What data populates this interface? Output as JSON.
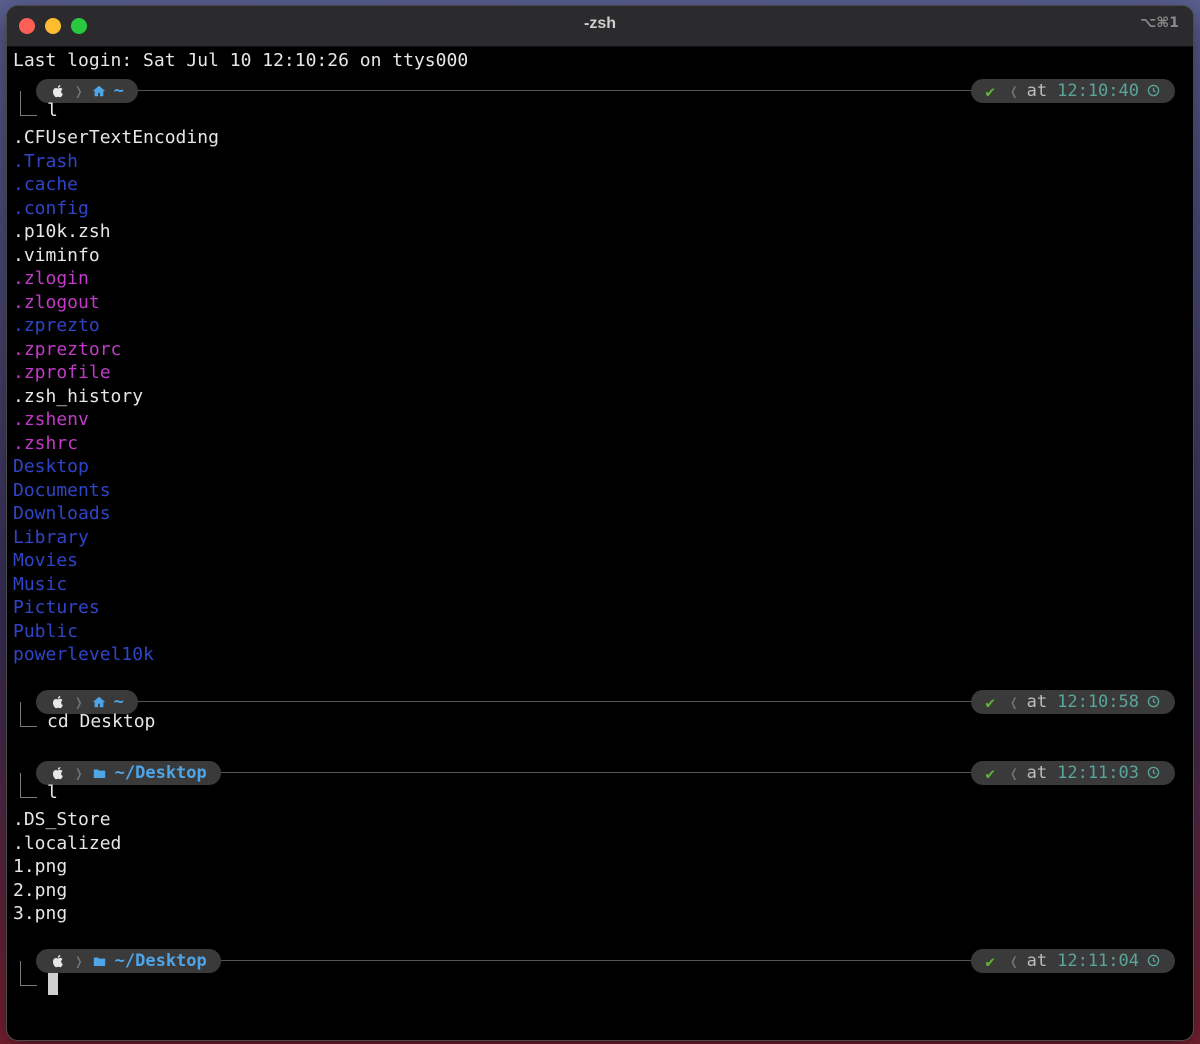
{
  "window": {
    "title": "-zsh",
    "shortcut": "⌥⌘1"
  },
  "last_login": "Last login: Sat Jul 10 12:10:26 on ttys000",
  "prompts": [
    {
      "dir_icon": "home-icon",
      "path": "~",
      "time_label": "at",
      "time": "12:10:40",
      "command": "l"
    },
    {
      "dir_icon": "home-icon",
      "path": "~",
      "time_label": "at",
      "time": "12:10:58",
      "command": "cd Desktop"
    },
    {
      "dir_icon": "folder-icon",
      "path": "~/Desktop",
      "time_label": "at",
      "time": "12:11:03",
      "command": "l"
    },
    {
      "dir_icon": "folder-icon",
      "path": "~/Desktop",
      "time_label": "at",
      "time": "12:11:04",
      "command": ""
    }
  ],
  "listing_home": [
    {
      "name": ".CFUserTextEncoding",
      "color": "#e6e6e6"
    },
    {
      "name": ".Trash",
      "color": "#2f45c8"
    },
    {
      "name": ".cache",
      "color": "#2f45c8"
    },
    {
      "name": ".config",
      "color": "#2f45c8"
    },
    {
      "name": ".p10k.zsh",
      "color": "#e6e6e6"
    },
    {
      "name": ".viminfo",
      "color": "#e6e6e6"
    },
    {
      "name": ".zlogin",
      "color": "#c33ac8"
    },
    {
      "name": ".zlogout",
      "color": "#c33ac8"
    },
    {
      "name": ".zprezto",
      "color": "#2f45c8"
    },
    {
      "name": ".zpreztorc",
      "color": "#c33ac8"
    },
    {
      "name": ".zprofile",
      "color": "#c33ac8"
    },
    {
      "name": ".zsh_history",
      "color": "#e6e6e6"
    },
    {
      "name": ".zshenv",
      "color": "#c33ac8"
    },
    {
      "name": ".zshrc",
      "color": "#c33ac8"
    },
    {
      "name": "Desktop",
      "color": "#2f45c8"
    },
    {
      "name": "Documents",
      "color": "#2f45c8"
    },
    {
      "name": "Downloads",
      "color": "#2f45c8"
    },
    {
      "name": "Library",
      "color": "#2f45c8"
    },
    {
      "name": "Movies",
      "color": "#2f45c8"
    },
    {
      "name": "Music",
      "color": "#2f45c8"
    },
    {
      "name": "Pictures",
      "color": "#2f45c8"
    },
    {
      "name": "Public",
      "color": "#2f45c8"
    },
    {
      "name": "powerlevel10k",
      "color": "#2f45c8"
    }
  ],
  "listing_desktop": [
    {
      "name": ".DS_Store",
      "color": "#e6e6e6"
    },
    {
      "name": ".localized",
      "color": "#e6e6e6"
    },
    {
      "name": "1.png",
      "color": "#e6e6e6"
    },
    {
      "name": "2.png",
      "color": "#e6e6e6"
    },
    {
      "name": "3.png",
      "color": "#e6e6e6"
    }
  ],
  "colors": {
    "status_ok": "#5fb336",
    "time": "#5aa59a",
    "path": "#4ea5e8"
  }
}
